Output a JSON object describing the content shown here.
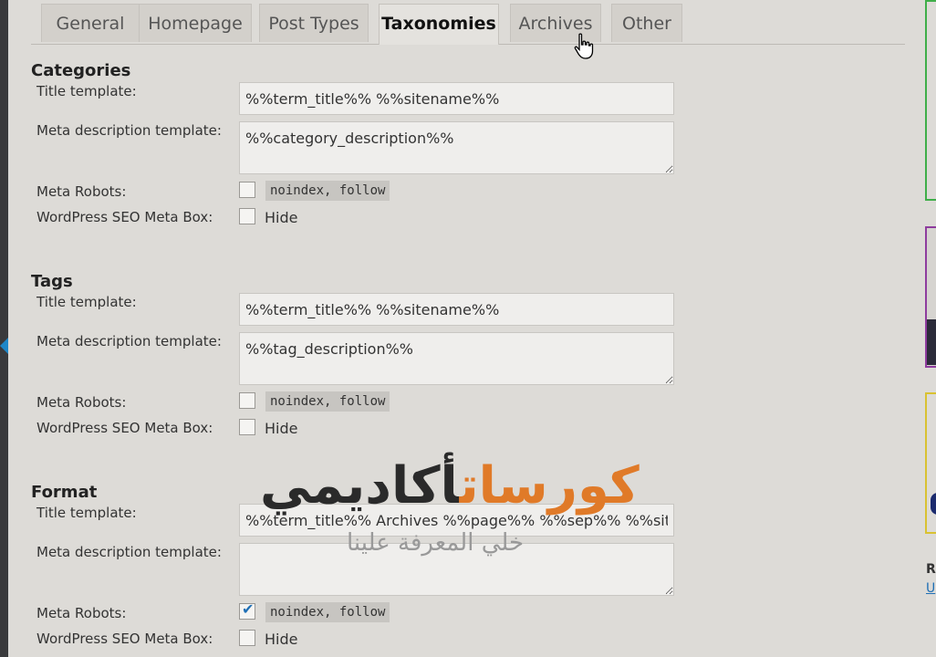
{
  "tabs": [
    "General",
    "Homepage",
    "Post Types",
    "Taxonomies",
    "Archives",
    "Other"
  ],
  "active_tab": "Taxonomies",
  "labels": {
    "title_template": "Title template:",
    "meta_description_template": "Meta description template:",
    "meta_robots": "Meta Robots:",
    "seo_meta_box": "WordPress SEO Meta Box:",
    "hide": "Hide",
    "noindex_follow": "noindex, follow"
  },
  "sections": [
    {
      "name": "Categories",
      "title_template": "%%term_title%% %%sitename%%",
      "meta_description": "%%category_description%%",
      "noindex_checked": false,
      "hide_checked": false
    },
    {
      "name": "Tags",
      "title_template": "%%term_title%% %%sitename%%",
      "meta_description": "%%tag_description%%",
      "noindex_checked": false,
      "hide_checked": false
    },
    {
      "name": "Format",
      "title_template": "%%term_title%% Archives %%page%% %%sep%% %%sitena",
      "meta_description": "",
      "noindex_checked": true,
      "hide_checked": false
    }
  ],
  "watermark": {
    "main_orange": "كورسات",
    "main_dark": "أكاديمي",
    "sub": "خلي المعرفة علينا"
  },
  "sidebar": {
    "letter_r": "R",
    "letter_u": "U"
  },
  "colors": {
    "accent": "#1f6fb5",
    "watermark_orange": "#e07a28"
  }
}
